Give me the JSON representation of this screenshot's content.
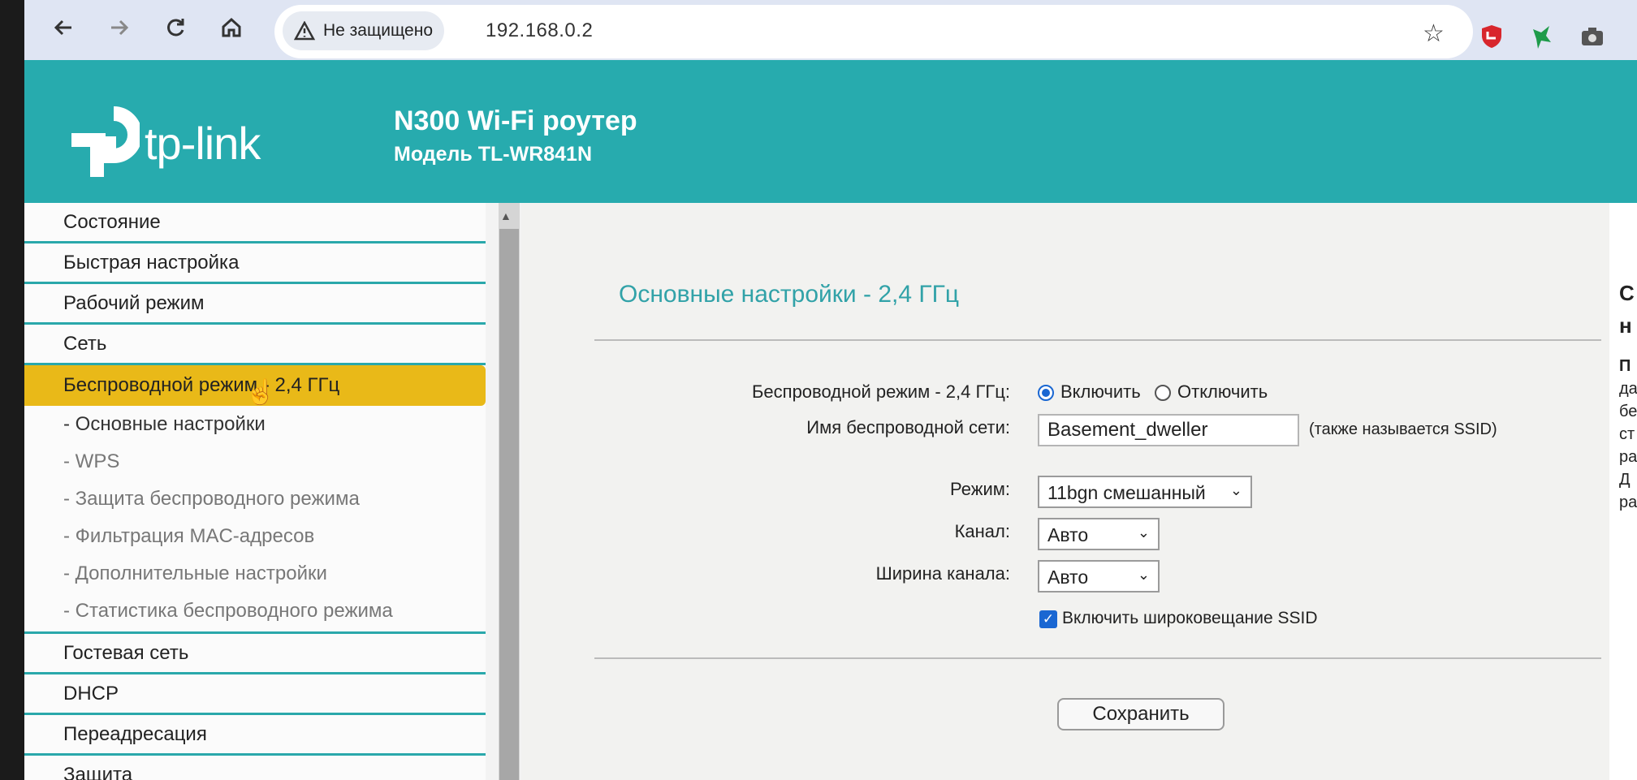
{
  "browser": {
    "security_chip": "Не защищено",
    "url": "192.168.0.2",
    "icons": [
      "back-icon",
      "forward-icon",
      "reload-icon",
      "home-icon",
      "warning-icon",
      "star-icon",
      "shield-extension-icon",
      "leaf-extension-icon",
      "camera-extension-icon"
    ]
  },
  "header": {
    "logo_text": "tp-link",
    "model_title": "N300 Wi-Fi роутер",
    "model_subtitle": "Модель TL-WR841N"
  },
  "sidebar": {
    "items": [
      {
        "label": "Состояние"
      },
      {
        "label": "Быстрая настройка"
      },
      {
        "label": "Рабочий режим"
      },
      {
        "label": "Сеть"
      },
      {
        "label": "Беспроводной режим - 2,4 ГГц",
        "active": true
      }
    ],
    "subitems": [
      {
        "label": "- Основные настройки"
      },
      {
        "label": "- WPS"
      },
      {
        "label": "- Защита беспроводного режима"
      },
      {
        "label": "- Фильтрация MAC-адресов"
      },
      {
        "label": "- Дополнительные настройки"
      },
      {
        "label": "- Статистика беспроводного режима"
      }
    ],
    "items_after": [
      {
        "label": "Гостевая сеть"
      },
      {
        "label": "DHCP"
      },
      {
        "label": "Переадресация"
      },
      {
        "label": "Защита"
      }
    ]
  },
  "main": {
    "title": "Основные настройки - 2,4 ГГц",
    "wireless_label": "Беспроводной режим - 2,4 ГГц:",
    "enable_option": "Включить",
    "disable_option": "Отключить",
    "ssid_label": "Имя беспроводной сети:",
    "ssid_value": "Basement_dweller",
    "ssid_note": "(также называется SSID)",
    "mode_label": "Режим:",
    "mode_value": "11bgn смешанный",
    "channel_label": "Канал:",
    "channel_value": "Авто",
    "width_label": "Ширина канала:",
    "width_value": "Авто",
    "broadcast_label": "Включить широковещание SSID",
    "save_button": "Сохранить"
  },
  "right_panel": {
    "lines": [
      "С",
      "н",
      "П",
      "да",
      "бе",
      "ст",
      "ра",
      "Д",
      "ра"
    ]
  },
  "colors": {
    "header_teal": "#27abae",
    "active_menu": "#e9b918",
    "title_teal": "#31a2a8",
    "accent_blue": "#1a67d2"
  }
}
